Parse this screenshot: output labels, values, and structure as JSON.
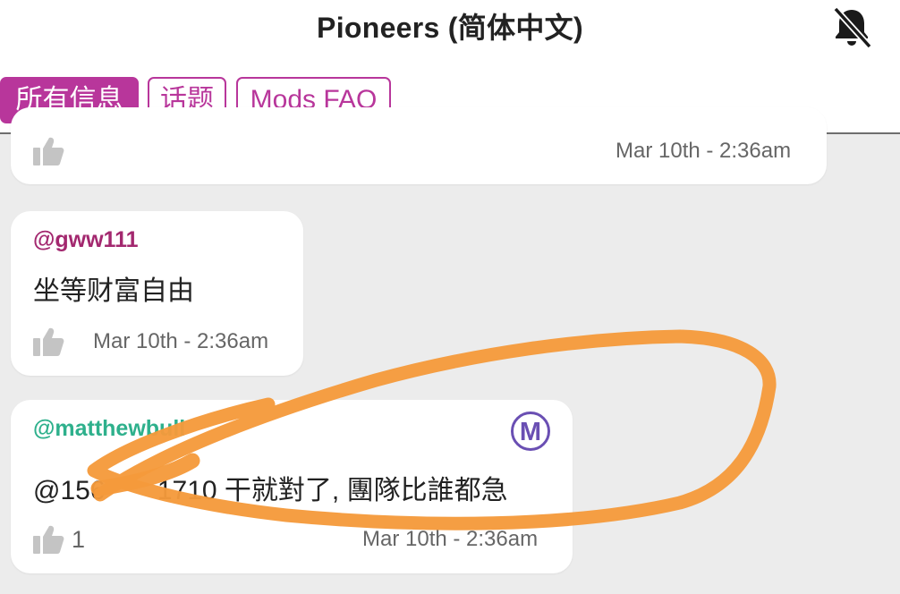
{
  "header": {
    "title": "Pioneers (简体中文)",
    "notification_icon": "bell-off-icon"
  },
  "tabs": [
    {
      "label": "所有信息",
      "active": true
    },
    {
      "label": "话题",
      "active": false
    },
    {
      "label": "Mods FAQ",
      "active": false
    }
  ],
  "messages": [
    {
      "timestamp": "Mar 10th - 2:36am"
    },
    {
      "author": "@gww111",
      "text": "坐等财富自由",
      "timestamp": "Mar 10th - 2:36am"
    },
    {
      "author": "@matthewbull",
      "text": "@156       1710 干就對了, 團隊比誰都急",
      "timestamp": "Mar 10th - 2:36am",
      "likes": "1",
      "badge": "M"
    }
  ],
  "colors": {
    "accent": "#b8369b",
    "author_purple": "#a3286f",
    "author_teal": "#2eb08c",
    "mod_badge": "#6a4fb3",
    "scribble": "#f59a3b"
  }
}
